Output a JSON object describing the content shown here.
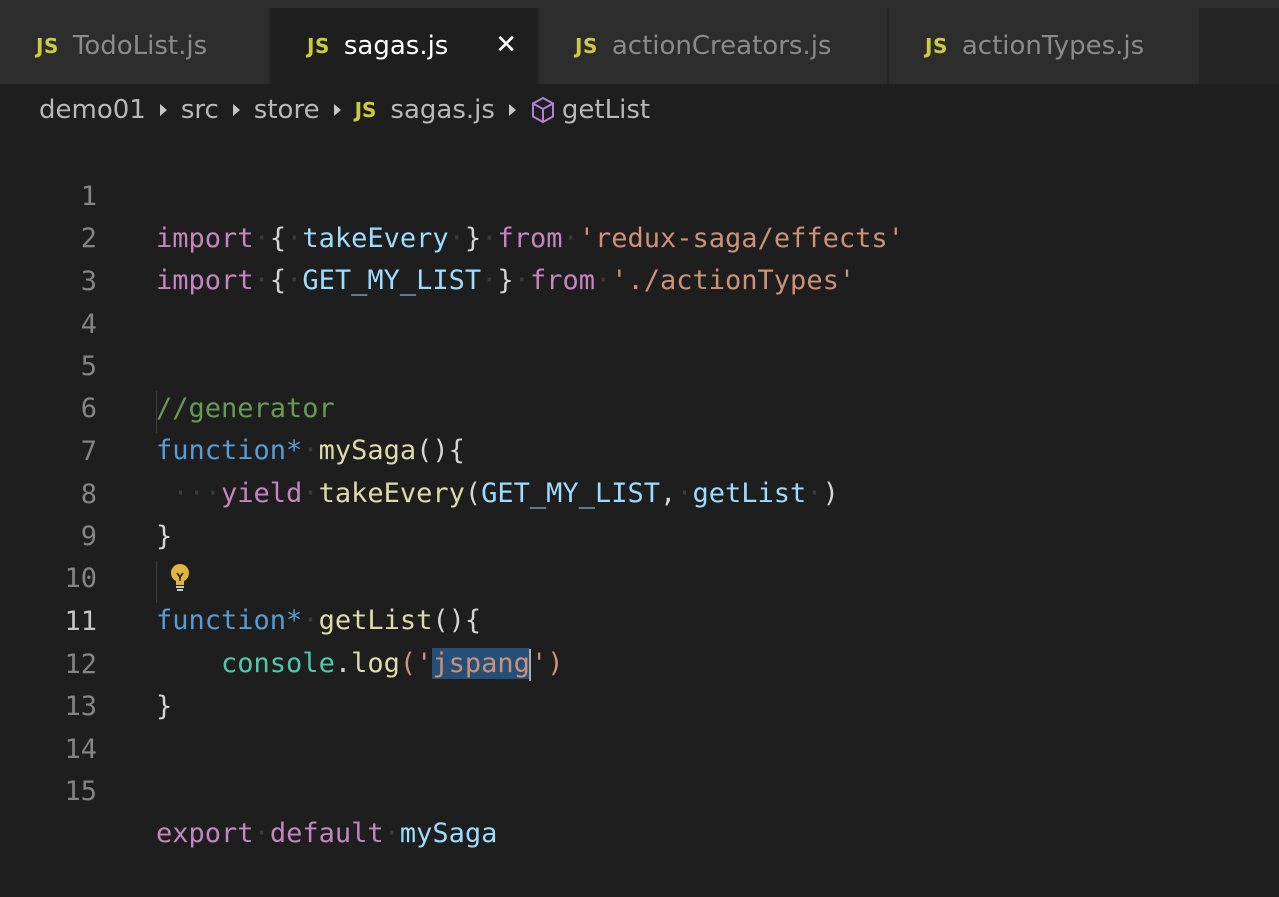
{
  "tabs": [
    {
      "icon": "JS",
      "label": "TodoList.js",
      "active": false
    },
    {
      "icon": "JS",
      "label": "sagas.js",
      "active": true,
      "close": "✕"
    },
    {
      "icon": "JS",
      "label": "actionCreators.js",
      "active": false
    },
    {
      "icon": "JS",
      "label": "actionTypes.js",
      "active": false
    }
  ],
  "breadcrumb": {
    "items": [
      "demo01",
      "src",
      "store"
    ],
    "file_icon": "JS",
    "file": "sagas.js",
    "symbol_icon": "cube-icon",
    "symbol": "getList"
  },
  "editor": {
    "active_line": 11,
    "line_numbers": [
      "1",
      "2",
      "3",
      "4",
      "5",
      "6",
      "7",
      "8",
      "9",
      "10",
      "11",
      "12",
      "13",
      "14",
      "15"
    ],
    "code": {
      "l1": {
        "import": "import",
        "open": "{",
        "name": "takeEvery",
        "close": "}",
        "from": "from",
        "str": "'redux-saga/effects'"
      },
      "l2": {
        "import": "import",
        "open": "{",
        "name": "GET_MY_LIST",
        "close": "}",
        "from": "from",
        "str": "'./actionTypes'"
      },
      "l5": {
        "comment": "//generator"
      },
      "l6": {
        "function": "function*",
        "name": "mySaga",
        "parens": "(){"
      },
      "l7": {
        "yield": "yield",
        "call": "takeEvery",
        "open": "(",
        "arg1": "GET_MY_LIST",
        "comma": ",",
        "arg2": "getList",
        "close": ")"
      },
      "l8": {
        "brace": "}"
      },
      "l10": {
        "function": "function*",
        "name": "getList",
        "parens": "(){"
      },
      "l11": {
        "obj": "console",
        "dot": ".",
        "method": "log",
        "open": "('",
        "selected": "jspang",
        "close": "')"
      },
      "l12": {
        "brace": "}"
      },
      "l15": {
        "export": "export",
        "default": "default",
        "name": "mySaga"
      }
    }
  },
  "colors": {
    "background": "#1e1e1e",
    "tab_inactive": "#2d2d2d",
    "js_icon": "#cbcb41",
    "keyword": "#c586c0",
    "string": "#ce9178",
    "function": "#dcdcaa",
    "variable": "#9cdcfe",
    "storage": "#569cd6",
    "comment": "#6a9955",
    "lightbulb": "#e2b53e"
  }
}
